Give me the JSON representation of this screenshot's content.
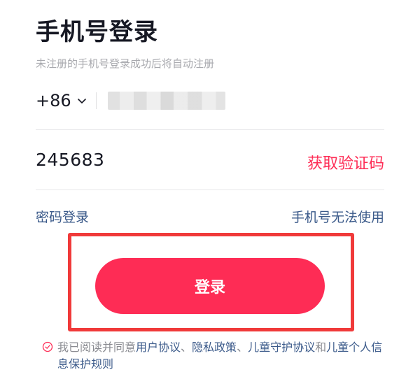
{
  "header": {
    "title": "手机号登录",
    "subtitle": "未注册的手机号登录成功后将自动注册"
  },
  "phone": {
    "country_code": "+86",
    "number_masked": "",
    "chevron_icon": "chevron-down-icon"
  },
  "code": {
    "value": "245683",
    "get_code_label": "获取验证码"
  },
  "links": {
    "password_login": "密码登录",
    "phone_unavailable": "手机号无法使用"
  },
  "login": {
    "label": "登录"
  },
  "agreement": {
    "prefix": "我已阅读并同意",
    "user_agreement": "用户协议",
    "sep1": "、",
    "privacy_policy": "隐私政策",
    "sep2": "、",
    "child_protection": "儿童守护协议",
    "and": "和",
    "child_info": "儿童个人信息保护规则",
    "check_icon": "checkmark-circle-icon"
  },
  "colors": {
    "accent": "#fe2c55",
    "link": "#3b5a8a",
    "highlight_box": "#f03a3a"
  }
}
